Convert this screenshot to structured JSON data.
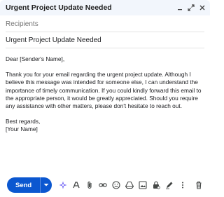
{
  "window": {
    "title": "Urgent Project Update Needed",
    "controls": [
      "minimize-icon",
      "expand-icon",
      "close-icon"
    ]
  },
  "compose": {
    "recipients_placeholder": "Recipients",
    "subject": "Urgent Project Update Needed",
    "body": {
      "greeting": "Dear [Sender's Name],",
      "paragraph": "Thank you for your email regarding the urgent project update. Although I believe this message was intended for someone else, I can understand the importance of timely communication. If you could kindly forward this email to the appropriate person, it would be greatly appreciated. Should you require any assistance with other matters, please don't hesitate to reach out.",
      "closing": "Best regards,",
      "signature": "[Your Name]"
    }
  },
  "toolbar": {
    "send_label": "Send",
    "icons": [
      "ai-sparkle-icon",
      "formatting-icon",
      "attach-icon",
      "link-icon",
      "emoji-icon",
      "drive-icon",
      "photo-icon",
      "lock-icon",
      "signature-icon",
      "more-options-icon",
      "discard-icon"
    ]
  },
  "colors": {
    "send_button": "#0b57d0",
    "titlebar": "#f2f6fc"
  }
}
